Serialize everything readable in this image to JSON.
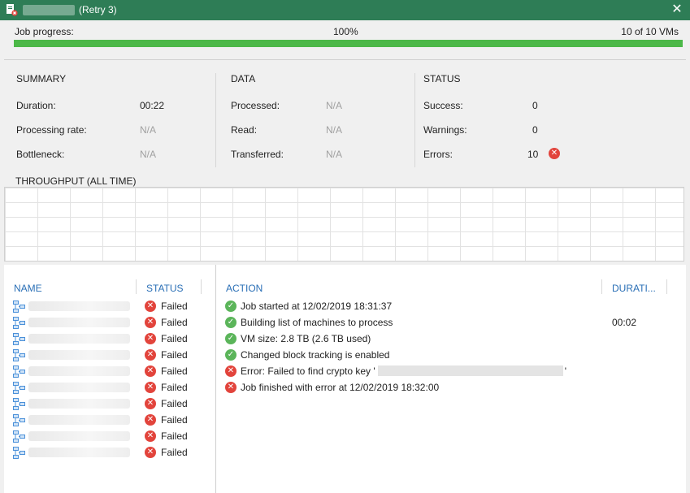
{
  "window": {
    "title_suffix": "(Retry 3)",
    "close_glyph": "✕",
    "accent": "#2e7d56"
  },
  "progress": {
    "label": "Job progress:",
    "percent_text": "100%",
    "percent": 100,
    "count_text": "10 of 10 VMs",
    "bar_color": "#4cb848"
  },
  "summary": {
    "title": "SUMMARY",
    "duration_label": "Duration:",
    "duration_value": "00:22",
    "rate_label": "Processing rate:",
    "rate_value": "N/A",
    "bottleneck_label": "Bottleneck:",
    "bottleneck_value": "N/A"
  },
  "data": {
    "title": "DATA",
    "processed_label": "Processed:",
    "processed_value": "N/A",
    "read_label": "Read:",
    "read_value": "N/A",
    "transferred_label": "Transferred:",
    "transferred_value": "N/A"
  },
  "status": {
    "title": "STATUS",
    "success_label": "Success:",
    "success_value": "0",
    "warnings_label": "Warnings:",
    "warnings_value": "0",
    "errors_label": "Errors:",
    "errors_value": "10",
    "error_icon": "error-icon"
  },
  "throughput": {
    "title": "THROUGHPUT (ALL TIME)"
  },
  "vm_table": {
    "name_header": "NAME",
    "status_header": "STATUS",
    "rows": [
      {
        "status": "Failed",
        "icon": "vm-icon"
      },
      {
        "status": "Failed",
        "icon": "vm-icon"
      },
      {
        "status": "Failed",
        "icon": "vm-icon"
      },
      {
        "status": "Failed",
        "icon": "vm-icon"
      },
      {
        "status": "Failed",
        "icon": "vm-icon"
      },
      {
        "status": "Failed",
        "icon": "vm-icon"
      },
      {
        "status": "Failed",
        "icon": "vm-icon"
      },
      {
        "status": "Failed",
        "icon": "vm-icon"
      },
      {
        "status": "Failed",
        "icon": "vm-icon"
      },
      {
        "status": "Failed",
        "icon": "vm-icon"
      }
    ]
  },
  "action_table": {
    "action_header": "ACTION",
    "duration_header": "DURATI...",
    "rows": [
      {
        "kind": "ok",
        "text": "Job started at 12/02/2019 18:31:37",
        "duration": ""
      },
      {
        "kind": "ok",
        "text": "Building list of machines to process",
        "duration": "00:02"
      },
      {
        "kind": "ok",
        "text": "VM size: 2.8 TB (2.6 TB used)",
        "duration": ""
      },
      {
        "kind": "ok",
        "text": "Changed block tracking is enabled",
        "duration": ""
      },
      {
        "kind": "fail",
        "text": "Error: Failed to find crypto key '",
        "text_after": "'",
        "duration": ""
      },
      {
        "kind": "fail",
        "text": "Job finished with error at 12/02/2019 18:32:00",
        "duration": ""
      }
    ],
    "ok_color": "#5bb55a",
    "fail_color": "#e2443c"
  }
}
